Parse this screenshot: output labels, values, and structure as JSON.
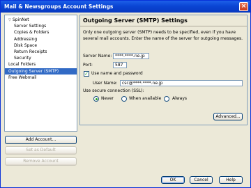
{
  "window": {
    "title": "Mail & Newsgroups Account Settings",
    "close_glyph": "×"
  },
  "tree": {
    "items": [
      {
        "label": "SpinNet",
        "level": 0,
        "caret": "▽"
      },
      {
        "label": "Server Settings",
        "level": 1
      },
      {
        "label": "Copies & Folders",
        "level": 1
      },
      {
        "label": "Addressing",
        "level": 1
      },
      {
        "label": "Disk Space",
        "level": 1
      },
      {
        "label": "Return Receipts",
        "level": 1
      },
      {
        "label": "Security",
        "level": 1
      },
      {
        "label": "Local Folders",
        "level": 0
      },
      {
        "label": "Outgoing Server (SMTP)",
        "level": 0,
        "selected": true
      },
      {
        "label": "Free Webmail",
        "level": 0
      }
    ]
  },
  "left_buttons": {
    "add_account": "Add Account...",
    "set_default": "Set as Default",
    "remove_account": "Remove Account"
  },
  "panel": {
    "title": "Outgoing Server (SMTP) Settings",
    "description": "Only one outgoing server (SMTP) needs to be specified, even if you have several mail accounts. Enter the name of the server for outgoing messages.",
    "server_name_label": "Server Name:",
    "server_name_value": "****.****.ne.jp",
    "port_label": "Port:",
    "port_value": "587",
    "use_name_label": "Use name and password",
    "use_name_checked": "✓",
    "user_name_label": "User Name:",
    "user_name_value": "csc@****.****.ne.jp",
    "ssl_label": "Use secure connection (SSL):",
    "ssl_options": {
      "never": "Never",
      "when_available": "When available",
      "always": "Always"
    },
    "ssl_selected": "never",
    "advanced_button": "Advanced..."
  },
  "footer": {
    "ok": "OK",
    "cancel": "Cancel",
    "help": "Help"
  }
}
